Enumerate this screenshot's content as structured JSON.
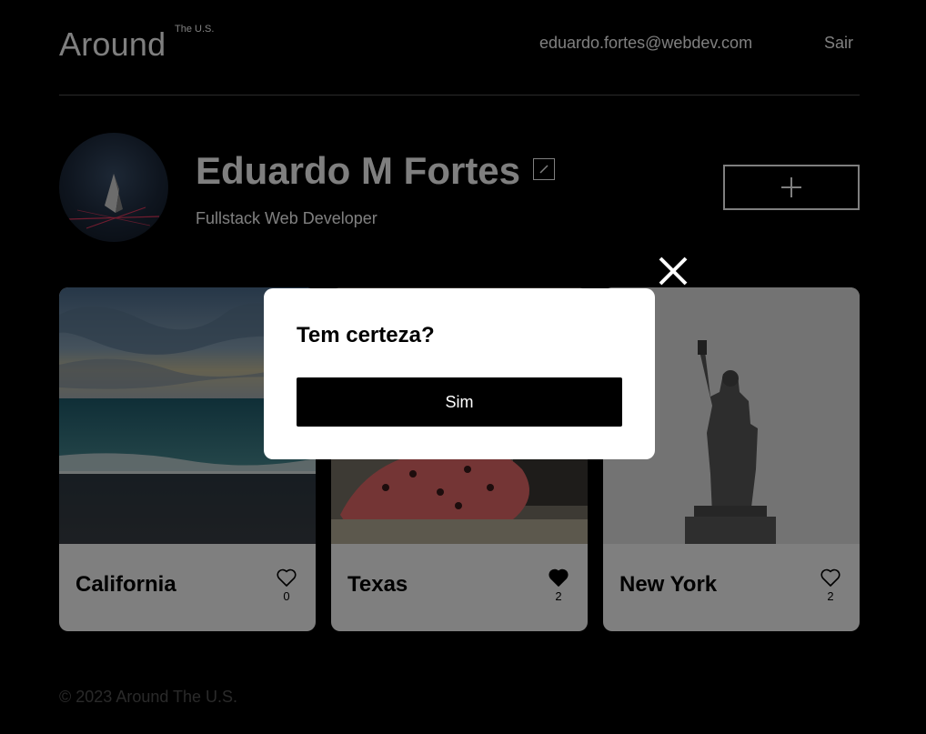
{
  "header": {
    "logo": "Around",
    "logo_sup": "The U.S.",
    "user_email": "eduardo.fortes@webdev.com",
    "logout": "Sair"
  },
  "profile": {
    "name": "Eduardo M Fortes",
    "about": "Fullstack Web Developer",
    "edit_icon": "pencil-icon",
    "add_icon": "plus-icon"
  },
  "cards": [
    {
      "title": "California",
      "likes": "0",
      "liked": false
    },
    {
      "title": "Texas",
      "likes": "2",
      "liked": true
    },
    {
      "title": "New York",
      "likes": "2",
      "liked": false
    }
  ],
  "footer": {
    "copyright": "© 2023 Around The U.S."
  },
  "popup": {
    "title": "Tem certeza?",
    "confirm_label": "Sim",
    "close_icon": "close-icon"
  },
  "colors": {
    "background": "#000000",
    "card": "#ffffff",
    "footer_text": "#545454",
    "overlay": "rgba(0,0,0,0.5)"
  }
}
